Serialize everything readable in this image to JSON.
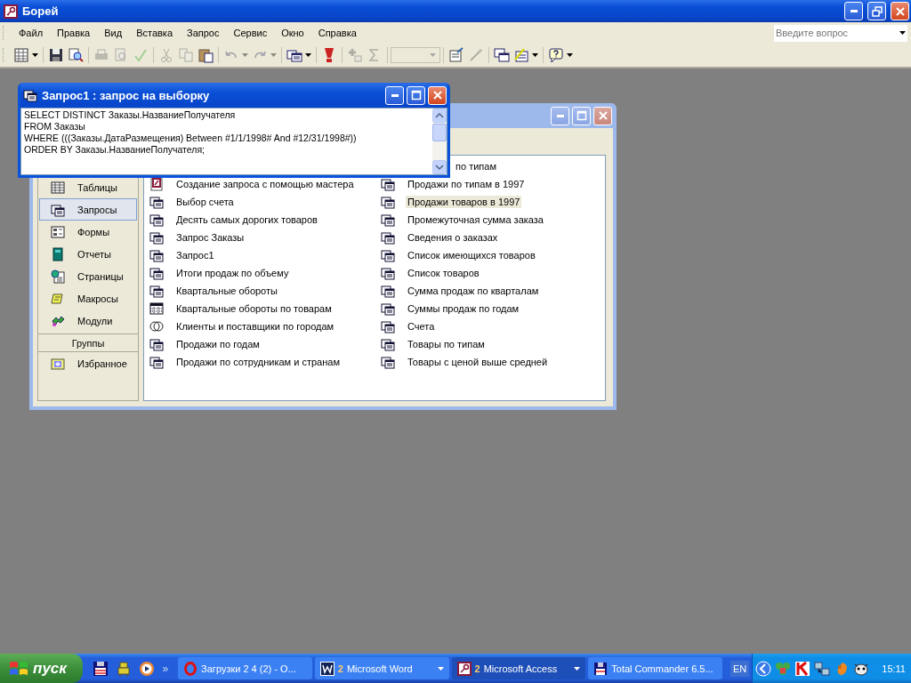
{
  "window": {
    "title": "Борей"
  },
  "menu": [
    "Файл",
    "Правка",
    "Вид",
    "Вставка",
    "Запрос",
    "Сервис",
    "Окно",
    "Справка"
  ],
  "help_field": {
    "placeholder": "Введите вопрос"
  },
  "toolbar": [
    {
      "kind": "view",
      "disabled": false,
      "dropdown": true
    },
    {
      "kind": "sep"
    },
    {
      "kind": "save",
      "disabled": false
    },
    {
      "kind": "search",
      "disabled": false
    },
    {
      "kind": "sep"
    },
    {
      "kind": "print",
      "disabled": true
    },
    {
      "kind": "preview",
      "disabled": true
    },
    {
      "kind": "spell",
      "disabled": true
    },
    {
      "kind": "sep"
    },
    {
      "kind": "cut",
      "disabled": true
    },
    {
      "kind": "copy",
      "disabled": true
    },
    {
      "kind": "paste",
      "disabled": false
    },
    {
      "kind": "sep"
    },
    {
      "kind": "undo",
      "disabled": true,
      "dropdown": true
    },
    {
      "kind": "redo",
      "disabled": true,
      "dropdown": true
    },
    {
      "kind": "sep"
    },
    {
      "kind": "query",
      "disabled": false,
      "dropdown": true
    },
    {
      "kind": "sep"
    },
    {
      "kind": "run",
      "disabled": false
    },
    {
      "kind": "sep"
    },
    {
      "kind": "add",
      "disabled": true
    },
    {
      "kind": "sigma",
      "disabled": true
    },
    {
      "kind": "sep"
    },
    {
      "kind": "combo",
      "disabled": true
    },
    {
      "kind": "sep"
    },
    {
      "kind": "props",
      "disabled": false
    },
    {
      "kind": "build",
      "disabled": true
    },
    {
      "kind": "sep"
    },
    {
      "kind": "dbwin",
      "disabled": false
    },
    {
      "kind": "newobj",
      "disabled": false,
      "dropdown": true
    },
    {
      "kind": "sep"
    },
    {
      "kind": "help",
      "disabled": false,
      "dropdown": true
    }
  ],
  "sql_window": {
    "title": "Запрос1 : запрос на выборку",
    "sql_lines": [
      "SELECT DISTINCT Заказы.НазваниеПолучателя",
      "FROM Заказы",
      "WHERE (((Заказы.ДатаРазмещения) Between #1/1/1998# And #12/31/1998#))",
      "ORDER BY Заказы.НазваниеПолучателя;"
    ]
  },
  "db_window": {
    "objects": [
      {
        "label": "Таблицы",
        "kind": "table",
        "selected": false
      },
      {
        "label": "Запросы",
        "kind": "query",
        "selected": true
      },
      {
        "label": "Формы",
        "kind": "form",
        "selected": false
      },
      {
        "label": "Отчеты",
        "kind": "report",
        "selected": false
      },
      {
        "label": "Страницы",
        "kind": "page",
        "selected": false
      },
      {
        "label": "Макросы",
        "kind": "macro",
        "selected": false
      },
      {
        "label": "Модули",
        "kind": "module",
        "selected": false
      }
    ],
    "groups_header": "Группы",
    "groups": [
      {
        "label": "Избранное",
        "kind": "favorites",
        "selected": false
      }
    ],
    "column_1": [
      {
        "label": "Создание запроса с помощью мастера",
        "kind": "wizard",
        "selected": false
      },
      {
        "label": "Выбор счета",
        "kind": "select",
        "selected": false
      },
      {
        "label": "Десять самых дорогих товаров",
        "kind": "select",
        "selected": false
      },
      {
        "label": "Запрос Заказы",
        "kind": "select",
        "selected": false
      },
      {
        "label": "Запрос1",
        "kind": "select",
        "selected": false
      },
      {
        "label": "Итоги продаж по объему",
        "kind": "select",
        "selected": false
      },
      {
        "label": "Квартальные обороты",
        "kind": "select",
        "selected": false
      },
      {
        "label": "Квартальные обороты по товарам",
        "kind": "crosstab",
        "selected": false
      },
      {
        "label": "Клиенты и поставщики по городам",
        "kind": "union",
        "selected": false
      },
      {
        "label": "Продажи по годам",
        "kind": "select",
        "selected": false
      },
      {
        "label": "Продажи по сотрудникам и странам",
        "kind": "select",
        "selected": false
      }
    ],
    "column_2": [
      {
        "label": "по типам",
        "kind": "text",
        "selected": false
      },
      {
        "label": "Продажи по типам в 1997",
        "kind": "select",
        "selected": false
      },
      {
        "label": "Продажи товаров в 1997",
        "kind": "select",
        "selected": true
      },
      {
        "label": "Промежуточная сумма заказа",
        "kind": "select",
        "selected": false
      },
      {
        "label": "Сведения о заказах",
        "kind": "select",
        "selected": false
      },
      {
        "label": "Список имеющихся товаров",
        "kind": "select",
        "selected": false
      },
      {
        "label": "Список товаров",
        "kind": "select",
        "selected": false
      },
      {
        "label": "Сумма продаж по кварталам",
        "kind": "select",
        "selected": false
      },
      {
        "label": "Суммы продаж по годам",
        "kind": "select",
        "selected": false
      },
      {
        "label": "Счета",
        "kind": "select",
        "selected": false
      },
      {
        "label": "Товары по типам",
        "kind": "select",
        "selected": false
      },
      {
        "label": "Товары с ценой выше средней",
        "kind": "select",
        "selected": false
      }
    ]
  },
  "taskbar": {
    "start": "пуск",
    "quick_launch": [
      {
        "kind": "disk"
      },
      {
        "kind": "robot"
      },
      {
        "kind": "player"
      }
    ],
    "more": "»",
    "tasks": [
      {
        "kind": "opera",
        "label": "Загрузки 2 4 (2) - О...",
        "selected": false
      },
      {
        "kind": "word",
        "count": "2",
        "label": "Microsoft Word",
        "selected": false,
        "dropdown": true
      },
      {
        "kind": "access",
        "count": "2",
        "label": "Microsoft Access",
        "selected": true,
        "dropdown": true
      },
      {
        "kind": "disk",
        "label": "Total Commander 6.5...",
        "selected": false
      }
    ],
    "language": "EN",
    "tray": [
      {
        "kind": "clover"
      },
      {
        "kind": "antivirus"
      },
      {
        "kind": "network"
      },
      {
        "kind": "squirrel"
      },
      {
        "kind": "cow"
      }
    ],
    "clock": "15:11"
  }
}
